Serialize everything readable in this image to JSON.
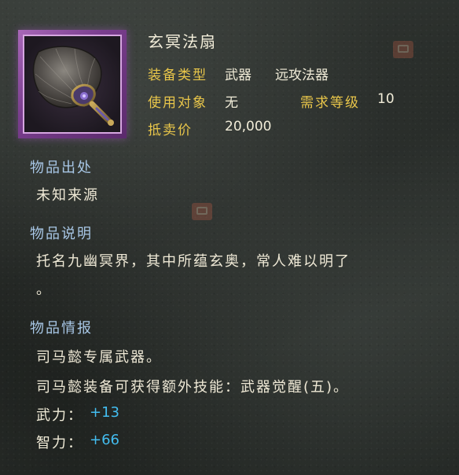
{
  "item": {
    "name": "玄冥法扇",
    "icon": "feather-fan-icon",
    "frame_color": "#8a4aa0"
  },
  "attributes": {
    "equip_type_label": "装备类型",
    "equip_type_value": "武器",
    "equip_subtype_value": "远攻法器",
    "target_label": "使用对象",
    "target_value": "无",
    "level_label": "需求等级",
    "level_value": "10",
    "price_label": "抵卖价",
    "price_value": "20,000"
  },
  "origin": {
    "header": "物品出处",
    "text": "未知来源"
  },
  "description": {
    "header": "物品说明",
    "line1": "托名九幽冥界，其中所蕴玄奥，常人难以明了",
    "line2": "。"
  },
  "info": {
    "header": "物品情报",
    "line1": "司马懿专属武器。",
    "line2": "司马懿装备可获得额外技能：武器觉醒(五)。"
  },
  "stats": [
    {
      "label": "武力：",
      "value": "+13"
    },
    {
      "label": "智力：",
      "value": "+66"
    }
  ],
  "colors": {
    "label_gold": "#e9c64a",
    "header_blue": "#a8c7e6",
    "stat_cyan": "#43bdf0",
    "text_cream": "#efe9d6"
  }
}
